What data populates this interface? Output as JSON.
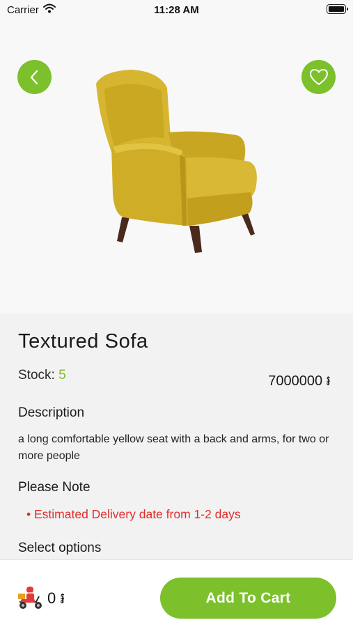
{
  "status_bar": {
    "carrier": "Carrier",
    "time": "11:28 AM"
  },
  "product": {
    "title": "Textured Sofa",
    "stock_label": "Stock:",
    "stock_value": "5",
    "price": "7000000 ៛",
    "description_heading": "Description",
    "description": "a long comfortable yellow seat with a back and arms, for two or more people",
    "note_heading": "Please Note",
    "note_item": "• Estimated Delivery date from 1-2 days",
    "options_heading": "Select options"
  },
  "bottom_bar": {
    "cart_total": "0 ៛",
    "add_to_cart_label": "Add To Cart"
  },
  "icons": {
    "back": "chevron-left-icon",
    "favorite": "heart-outline-icon",
    "delivery": "delivery-scooter-icon",
    "wifi": "wifi-icon",
    "battery": "battery-icon"
  },
  "colors": {
    "accent": "#7cc02b",
    "note": "#e22b2b",
    "background": "#f2f2f2",
    "image_background": "#f8f8f8"
  }
}
